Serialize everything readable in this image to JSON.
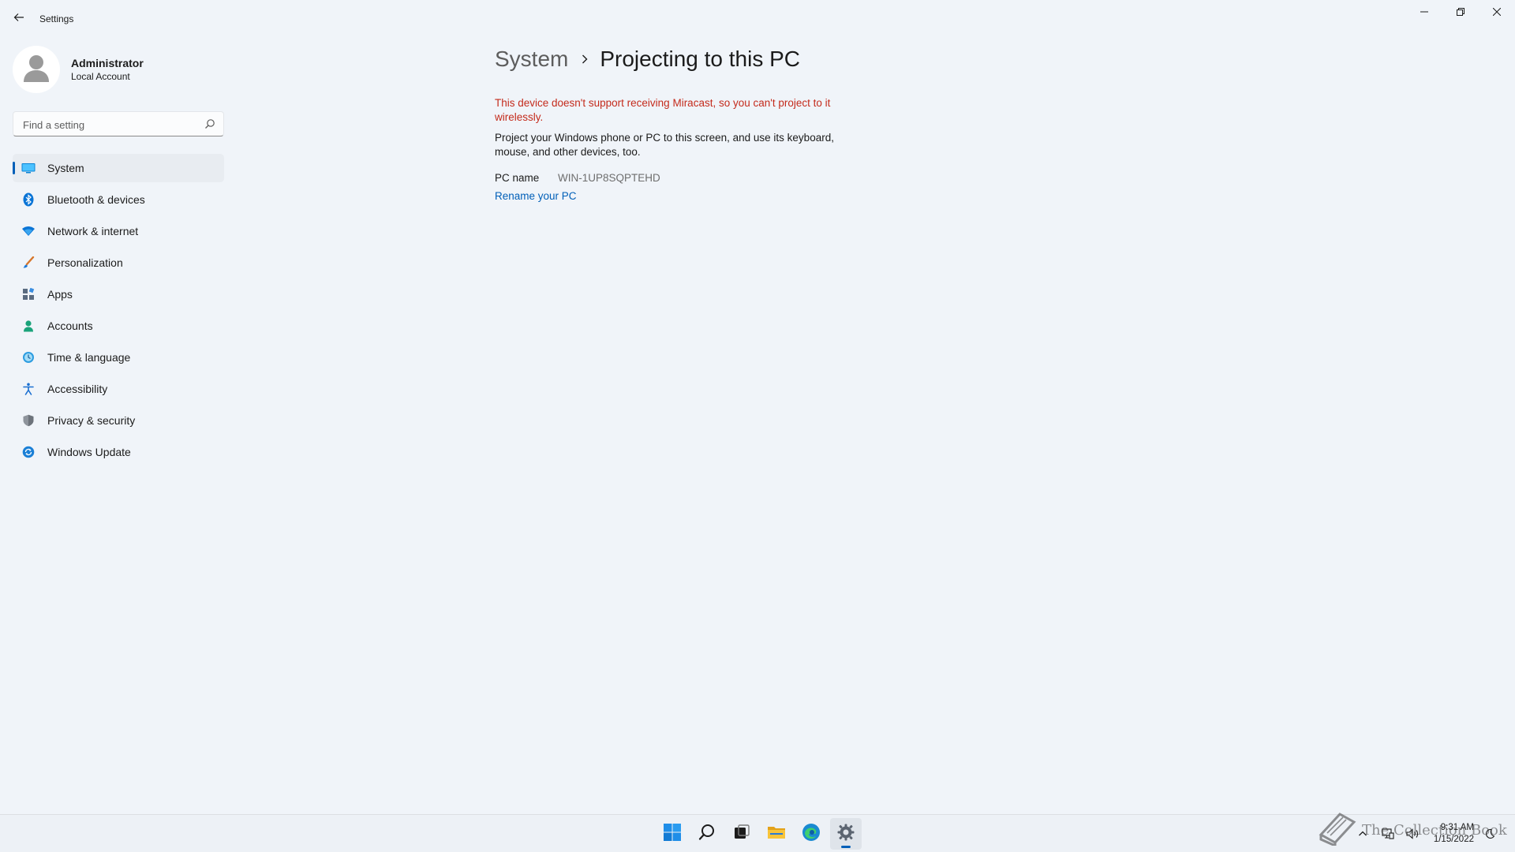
{
  "window": {
    "title": "Settings",
    "back_icon": "back-arrow-icon",
    "controls": [
      "minimize-icon",
      "restore-icon",
      "close-icon"
    ]
  },
  "profile": {
    "name": "Administrator",
    "account_type": "Local Account"
  },
  "search": {
    "placeholder": "Find a setting",
    "value": ""
  },
  "sidebar": {
    "items": [
      {
        "label": "System",
        "icon": "system-icon",
        "selected": true
      },
      {
        "label": "Bluetooth & devices",
        "icon": "bluetooth-icon"
      },
      {
        "label": "Network & internet",
        "icon": "network-icon"
      },
      {
        "label": "Personalization",
        "icon": "brush-icon"
      },
      {
        "label": "Apps",
        "icon": "apps-icon"
      },
      {
        "label": "Accounts",
        "icon": "accounts-icon"
      },
      {
        "label": "Time & language",
        "icon": "time-language-icon"
      },
      {
        "label": "Accessibility",
        "icon": "accessibility-icon"
      },
      {
        "label": "Privacy & security",
        "icon": "shield-icon"
      },
      {
        "label": "Windows Update",
        "icon": "windows-update-icon"
      }
    ]
  },
  "main": {
    "breadcrumb_parent": "System",
    "page_title": "Projecting to this PC",
    "warning": "This device doesn't support receiving Miracast, so you can't project to it wirelessly.",
    "description": "Project your Windows phone or PC to this screen, and use its keyboard, mouse, and other devices, too.",
    "pc_name_label": "PC name",
    "pc_name_value": "WIN-1UP8SQPTEHD",
    "rename_link": "Rename your PC"
  },
  "taskbar": {
    "pinned": [
      "start-icon",
      "search-icon",
      "task-view-icon",
      "file-explorer-icon",
      "edge-icon",
      "settings-icon"
    ],
    "active": "settings-icon",
    "tray": [
      "chevron-up-icon",
      "network-tray-icon",
      "volume-icon"
    ],
    "time": "9:31 AM",
    "date": "1/15/2022"
  },
  "watermark": {
    "text": "The Collection Book"
  },
  "colors": {
    "accent": "#005fb8",
    "warning": "#c42b1c",
    "background": "#f0f4f9"
  }
}
